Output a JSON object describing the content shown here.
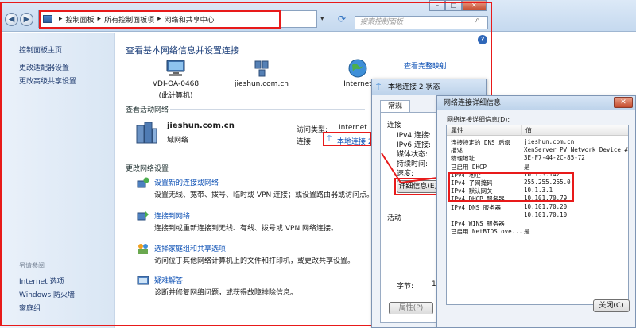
{
  "address": {
    "crumbs": [
      "控制面板",
      "所有控制面板项",
      "网络和共享中心"
    ],
    "search_placeholder": "搜索控制面板"
  },
  "window_controls": {
    "minimize": "–",
    "maximize": "□",
    "close": "✕"
  },
  "sidebar": {
    "items": [
      "控制面板主页",
      "更改适配器设置",
      "更改高级共享设置"
    ],
    "see_also_label": "另请参阅",
    "see_also": [
      "Internet 选项",
      "Windows 防火墙",
      "家庭组"
    ]
  },
  "main": {
    "title": "查看基本网络信息并设置连接",
    "full_map_link": "查看完整映射",
    "map": {
      "computer_name": "VDI-OA-0468",
      "computer_sub": "(此计算机)",
      "network_name": "jieshun.com.cn",
      "internet": "Internet"
    },
    "active_networks_label": "查看活动网络",
    "active_network": {
      "name": "jieshun.com.cn",
      "type": "域网络",
      "access_type_label": "访问类型:",
      "access_type_value": "Internet",
      "connection_label": "连接:",
      "connection_value": "本地连接 2"
    },
    "change_settings_label": "更改网络设置",
    "tasks": [
      {
        "title": "设置新的连接或网络",
        "desc": "设置无线、宽带、拨号、临时或 VPN 连接；或设置路由器或访问点。"
      },
      {
        "title": "连接到网络",
        "desc": "连接到或重新连接到无线、有线、拨号或 VPN 网络连接。"
      },
      {
        "title": "选择家庭组和共享选项",
        "desc": "访问位于其他网络计算机上的文件和打印机，或更改共享设置。"
      },
      {
        "title": "疑难解答",
        "desc": "诊断并修复网络问题，或获得故障排除信息。"
      }
    ]
  },
  "status_dialog": {
    "title": "本地连接 2 状态",
    "tab": "常规",
    "connection_group": "连接",
    "rows": [
      "IPv4 连接:",
      "IPv6 连接:",
      "媒体状态:",
      "持续时间:",
      "速度:"
    ],
    "details_button": "详细信息(E)...",
    "activity_group": "活动",
    "bytes_label": "字节:",
    "bytes_value": "12",
    "properties_button": "属性(P)"
  },
  "detail_dialog": {
    "title": "网络连接详细信息",
    "subtitle": "网络连接详细信息(D):",
    "col_property": "属性",
    "col_value": "值",
    "rows": [
      {
        "p": "连接特定的 DNS 后缀",
        "v": "jieshun.com.cn"
      },
      {
        "p": "描述",
        "v": "XenServer PV Network Device #0"
      },
      {
        "p": "物理地址",
        "v": "3E-F7-44-2C-85-72"
      },
      {
        "p": "已启用 DHCP",
        "v": "是"
      },
      {
        "p": "IPv4 地址",
        "v": "10.1.3.142"
      },
      {
        "p": "IPv4 子网掩码",
        "v": "255.255.255.0"
      },
      {
        "p": "IPv4 默认网关",
        "v": "10.1.3.1"
      },
      {
        "p": "IPv4 DHCP 服务器",
        "v": "10.101.70.79"
      },
      {
        "p": "IPv4 DNS 服务器",
        "v": "10.101.70.20"
      },
      {
        "p": "",
        "v": "10.101.70.10"
      },
      {
        "p": "IPv4 WINS 服务器",
        "v": ""
      },
      {
        "p": "已启用 NetBIOS ove...",
        "v": "是"
      }
    ],
    "close_button": "关闭(C)"
  }
}
